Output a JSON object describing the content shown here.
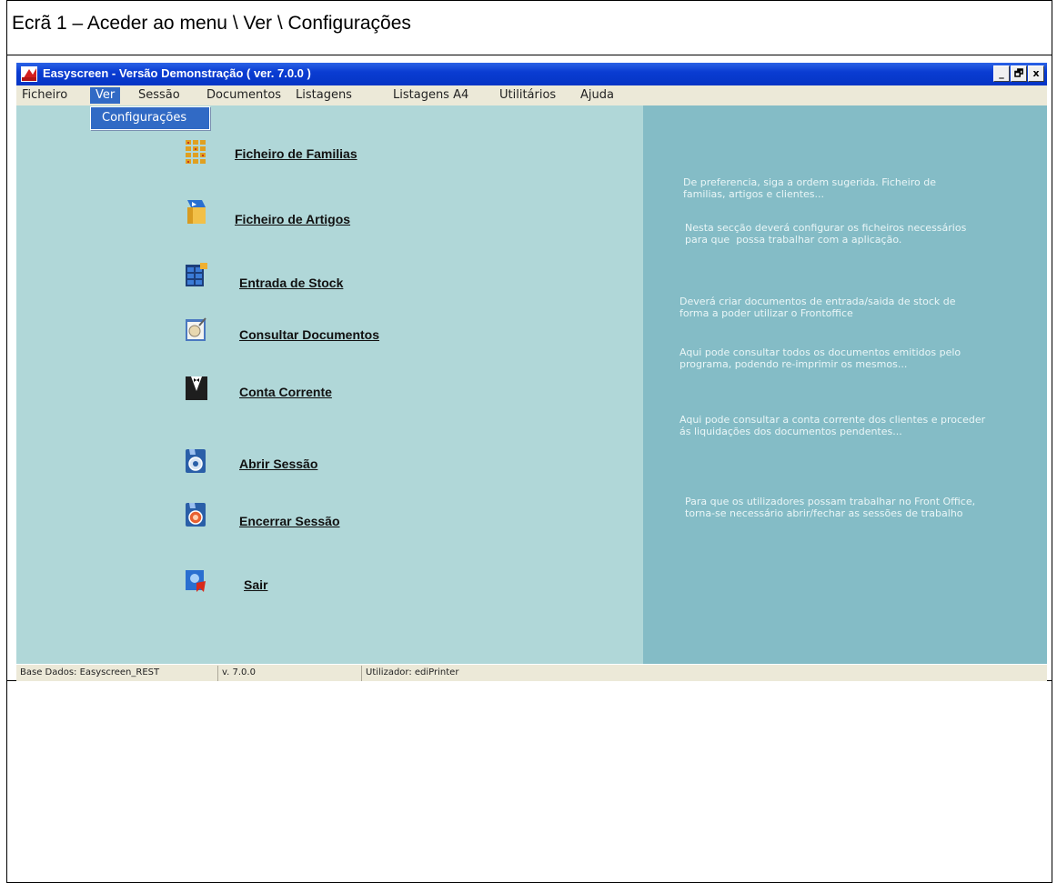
{
  "caption": "Ecrã 1 – Aceder ao menu \\ Ver \\ Configurações",
  "window": {
    "title": "Easyscreen - Versão Demonstração  ( ver. 7.0.0 )",
    "buttons": {
      "minimize": "_",
      "restore": "🗗",
      "close": "x"
    }
  },
  "menu": {
    "items": [
      "Ficheiro",
      "Ver",
      "Sessão",
      "Documentos",
      "Listagens",
      "Listagens A4",
      "Utilitários",
      "Ajuda"
    ],
    "active": "Ver",
    "dropdown": [
      "Configurações"
    ]
  },
  "nav": [
    {
      "label": "Ficheiro de Familias",
      "icon": "families-grid-icon"
    },
    {
      "label": "Ficheiro de Artigos",
      "icon": "articles-box-icon"
    },
    {
      "label": "Entrada de Stock",
      "icon": "stock-entry-icon"
    },
    {
      "label": "Consultar Documentos",
      "icon": "documents-search-icon"
    },
    {
      "label": "Conta Corrente",
      "icon": "tuxedo-icon"
    },
    {
      "label": "Abrir Sessão",
      "icon": "open-session-icon"
    },
    {
      "label": "Encerrar Sessão",
      "icon": "close-session-icon"
    },
    {
      "label": "Sair",
      "icon": "exit-icon"
    }
  ],
  "hints": [
    "De preferencia, siga a ordem sugerida. Ficheiro de\nfamilias, artigos e clientes...",
    "Nesta secção deverá configurar os ficheiros necessários\npara que  possa trabalhar com a aplicação.",
    "Deverá criar documentos de entrada/saida de stock de\nforma a poder utilizar o Frontoffice",
    "Aqui pode consultar todos os documentos emitidos pelo\nprograma, podendo re-imprimir os mesmos...",
    "Aqui pode consultar a conta corrente dos clientes e proceder\nás liquidações dos documentos pendentes...",
    "Para que os utilizadores possam trabalhar no Front Office,\ntorna-se necessário abrir/fechar as sessões de trabalho"
  ],
  "status": {
    "database": "Base Dados: Easyscreen_REST",
    "version": "v. 7.0.0",
    "user": "Utilizador: ediPrinter"
  },
  "colors": {
    "titlebar": "#0a3cd2",
    "main_panel": "#b0d7d8",
    "side_panel": "#84bcc6",
    "menu_highlight": "#316ac5"
  }
}
